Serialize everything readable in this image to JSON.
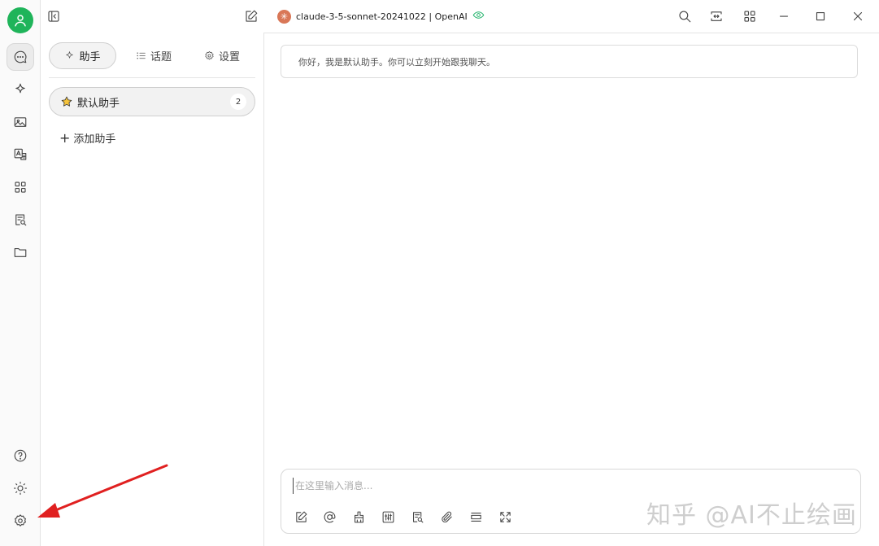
{
  "title_bar": {
    "model_name": "claude-3-5-sonnet-20241022 | OpenAI",
    "model_logo_glyph": "✳"
  },
  "tabs": [
    {
      "label": "助手",
      "icon": "sparkle-icon",
      "active": true
    },
    {
      "label": "话题",
      "icon": "list-icon",
      "active": false
    },
    {
      "label": "设置",
      "icon": "gear-icon",
      "active": false
    }
  ],
  "assistants": [
    {
      "name": "默认助手",
      "topic_count": "2",
      "icon": "star-icon"
    }
  ],
  "add_assistant_label": "添加助手",
  "chat": {
    "greeting": "你好，我是默认助手。你可以立刻开始跟我聊天。",
    "input_placeholder": "在这里输入消息..."
  },
  "watermark": "知乎 @AI不止绘画",
  "colors": {
    "avatar": "#1fb45a",
    "model_logo": "#d97757",
    "eye": "#22b36b",
    "arrow": "#e02020"
  }
}
